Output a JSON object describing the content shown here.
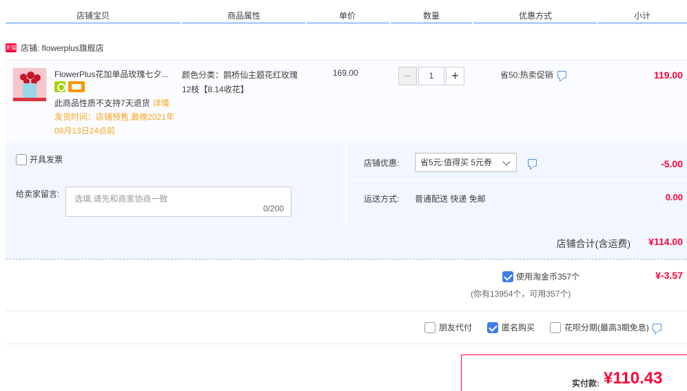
{
  "columns": [
    "店铺宝贝",
    "商品属性",
    "单价",
    "数量",
    "优惠方式",
    "小计"
  ],
  "shop": {
    "badge": "天猫",
    "label": "店铺: flowerplus旗舰店"
  },
  "item": {
    "title": "FlowerPlus花加单品玫瑰七夕...",
    "no_return": "此商品性质不支持7天退货",
    "details_link": "详情",
    "ship_time": "发货时间：店铺预售,最晚2021年08月13日24点前",
    "attr": "颜色分类：鹊桥仙主题花红玫瑰12枝【8.14收花】",
    "price": "169.00",
    "qty": "1",
    "minus": "−",
    "plus": "+",
    "promo": "省50:热卖促销",
    "subtotal": "119.00"
  },
  "options": {
    "invoice_label": "开具发票",
    "message_label": "给卖家留言:",
    "message_placeholder": "选填,请先和商家协商一致",
    "message_count": "0/200",
    "shop_discount_label": "店铺优惠:",
    "coupon_selected": "省5元:值得买 5元券",
    "discount_amount": "-5.00",
    "shipping_label": "运送方式:",
    "shipping_value": "普通配送 快递 免邮",
    "shipping_amount": "0.00"
  },
  "shop_total": {
    "label": "店铺合计(含运费)",
    "amount": "¥114.00"
  },
  "coins": {
    "label": "使用淘金币357个",
    "amount": "¥-3.57",
    "sub": "(你有13954个，可用357个)"
  },
  "pay_options": [
    {
      "label": "朋友代付",
      "checked": false
    },
    {
      "label": "匿名购买",
      "checked": true
    },
    {
      "label": "花呗分期(最高3期免息)",
      "checked": false
    }
  ],
  "final": {
    "label": "实付款:",
    "amount": "¥110.43"
  }
}
